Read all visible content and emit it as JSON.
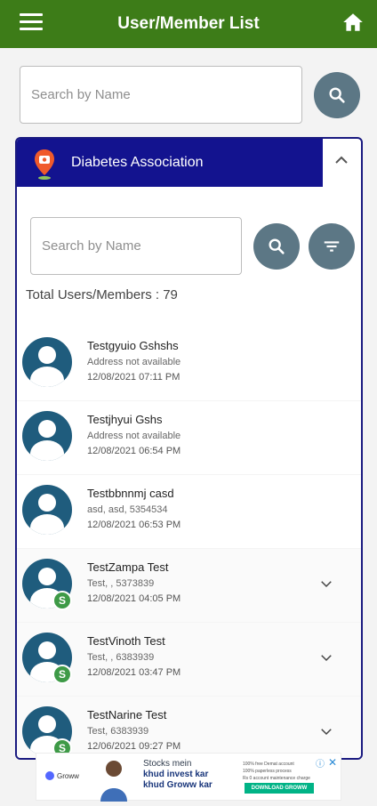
{
  "header": {
    "title": "User/Member List"
  },
  "search": {
    "placeholder": "Search by Name"
  },
  "association": {
    "name": "Diabetes Association",
    "search_placeholder": "Search by Name"
  },
  "total": {
    "label": "Total Users/Members : 79"
  },
  "members": [
    {
      "name": "Testgyuio Gshshs",
      "address": "Address not available",
      "date": "12/08/2021  07:11 PM",
      "badge": "",
      "expandable": false
    },
    {
      "name": "Testjhyui Gshs",
      "address": "Address not available",
      "date": "12/08/2021  06:54 PM",
      "badge": "",
      "expandable": false
    },
    {
      "name": "Testbbnnmj casd",
      "address": "asd, asd, 5354534",
      "date": "12/08/2021  06:53 PM",
      "badge": "",
      "expandable": false
    },
    {
      "name": "TestZampa Test",
      "address": "Test, , 5373839",
      "date": "12/08/2021  04:05 PM",
      "badge": "S",
      "expandable": true
    },
    {
      "name": "TestVinoth Test",
      "address": "Test, , 6383939",
      "date": "12/08/2021  03:47 PM",
      "badge": "S",
      "expandable": true
    },
    {
      "name": "TestNarine Test",
      "address": "Test, 6383939",
      "date": "12/06/2021  09:27 PM",
      "badge": "S",
      "expandable": true
    }
  ],
  "ad": {
    "brand": "Groww",
    "line1": "Stocks mein",
    "line2": "khud invest kar",
    "line3": "khud Groww kar",
    "bullet1": "100% free Demat account",
    "bullet2": "100% paperless process",
    "bullet3": "Rs 0 account maintenance charge",
    "cta": "DOWNLOAD GROWW"
  },
  "colors": {
    "appbar": "#3d7c18",
    "panel_header": "#13138f",
    "avatar": "#1f5c7d",
    "badge": "#3e9a47",
    "circle_button": "#5c7785"
  }
}
